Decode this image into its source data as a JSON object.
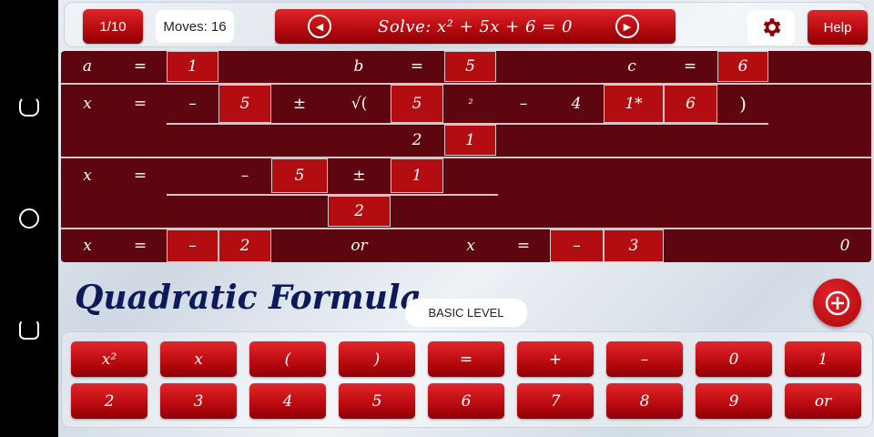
{
  "top": {
    "level": "1/10",
    "moves": "Moves: 16",
    "equation": "Solve: x² + 5x + 6 = 0",
    "help": "Help"
  },
  "board": {
    "row1": {
      "a": "a",
      "eq1": "=",
      "a_val": "1",
      "b": "b",
      "eq2": "=",
      "b_val": "5",
      "c": "c",
      "eq3": "=",
      "c_val": "6"
    },
    "row2": {
      "x": "x",
      "eq": "=",
      "minus": "–",
      "b1": "5",
      "pm": "±",
      "sqrt": "√(",
      "b2": "5",
      "sq": "²",
      "minus2": "–",
      "four": "4",
      "one_star": "1*",
      "c": "6",
      "close": ")"
    },
    "row3": {
      "two": "2",
      "one": "1"
    },
    "row4": {
      "x": "x",
      "eq": "=",
      "minus": "–",
      "five": "5",
      "pm": "±",
      "one": "1"
    },
    "row5": {
      "two": "2"
    },
    "row6": {
      "x1": "x",
      "eq1": "=",
      "minus1": "–",
      "r1": "2",
      "or": "or",
      "x2": "x",
      "eq2": "=",
      "minus2": "–",
      "r2": "3",
      "zero": "0"
    }
  },
  "footer": {
    "title": "Quadratic Formula",
    "level_badge": "BASIC LEVEL"
  },
  "keypad": {
    "row1": [
      "x²",
      "x",
      "(",
      ")",
      "=",
      "+",
      "–",
      "0",
      "1"
    ],
    "row2": [
      "2",
      "3",
      "4",
      "5",
      "6",
      "7",
      "8",
      "9",
      "or"
    ]
  },
  "icons": [
    "back-nav-icon",
    "home-nav-icon",
    "recent-apps-icon",
    "prev-arrow-icon",
    "next-arrow-icon",
    "gear-icon",
    "plus-icon"
  ],
  "colors": {
    "accent": "#b30d12",
    "board": "#5e0610",
    "title": "#0d1a5a"
  }
}
